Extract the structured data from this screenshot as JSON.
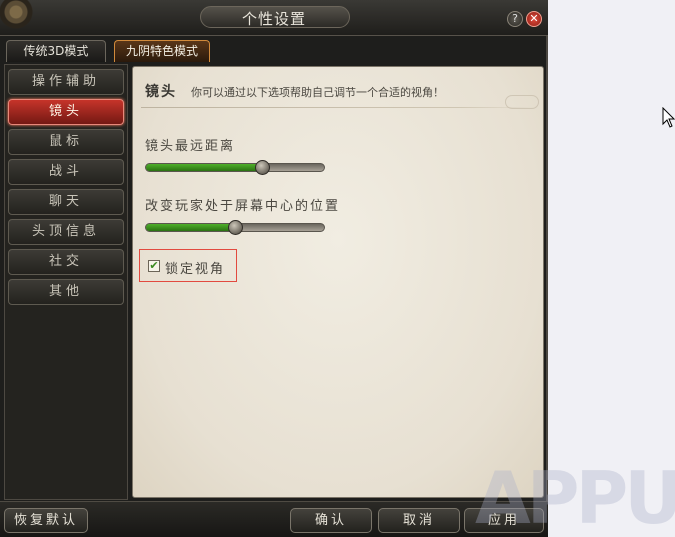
{
  "window": {
    "title": "个性设置",
    "help_label": "?",
    "close_label": "✕"
  },
  "tabs": [
    {
      "label": "传统3D模式",
      "active": false
    },
    {
      "label": "九阴特色模式",
      "active": true
    }
  ],
  "sidebar": {
    "items": [
      {
        "label": "操作辅助",
        "active": false
      },
      {
        "label": "镜头",
        "active": true
      },
      {
        "label": "鼠标",
        "active": false
      },
      {
        "label": "战斗",
        "active": false
      },
      {
        "label": "聊天",
        "active": false
      },
      {
        "label": "头顶信息",
        "active": false
      },
      {
        "label": "社交",
        "active": false
      },
      {
        "label": "其他",
        "active": false
      }
    ]
  },
  "content": {
    "title": "镜头",
    "description": "你可以通过以下选项帮助自己调节一个合适的视角！",
    "settings": [
      {
        "label": "镜头最远距离",
        "value": 0.65
      },
      {
        "label": "改变玩家处于屏幕中心的位置",
        "value": 0.5
      }
    ],
    "checkbox": {
      "label": "锁定视角",
      "checked": true,
      "mark": "✔"
    }
  },
  "bottom": {
    "restore_default": "恢复默认",
    "confirm": "确认",
    "cancel": "取消",
    "apply": "应用"
  },
  "watermark": "APPUN",
  "colors": {
    "active_nav": "#c6342a",
    "slider_fill": "#4fb02a",
    "highlight_box": "#e24a3f"
  }
}
